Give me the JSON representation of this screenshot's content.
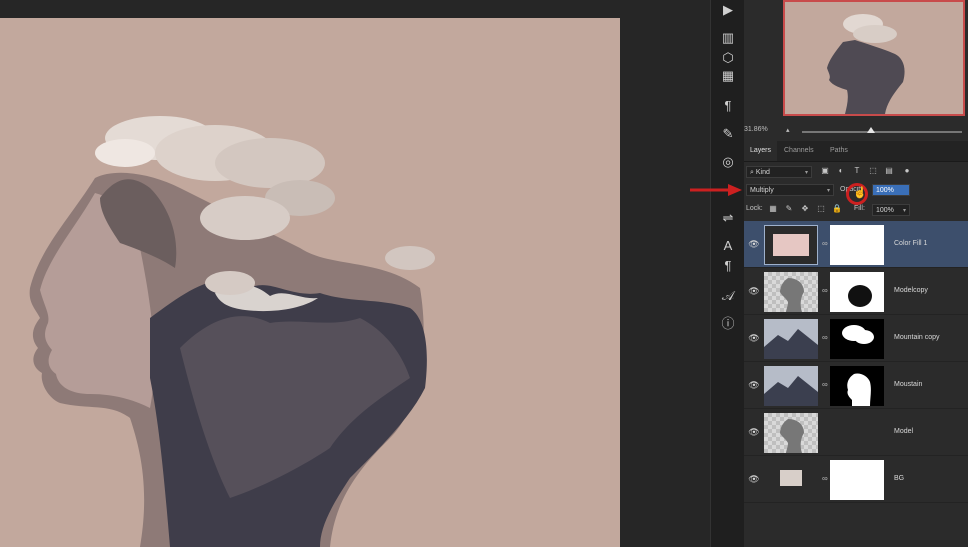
{
  "canvas": {
    "background_color": "#c2a89d",
    "artwork": "double-exposure-portrait"
  },
  "tools": [
    {
      "icon": "play-icon"
    },
    {
      "icon": "histogram-icon"
    },
    {
      "icon": "3d-cube-icon"
    },
    {
      "icon": "swatches-icon"
    },
    {
      "icon": "paragraph-styles-icon"
    },
    {
      "icon": "brush-presets-icon"
    },
    {
      "icon": "libraries-icon"
    },
    {
      "icon": "adjust-levels-icon"
    },
    {
      "icon": "character-icon"
    },
    {
      "icon": "paragraph-icon"
    },
    {
      "icon": "glyphs-icon"
    },
    {
      "icon": "info-icon"
    }
  ],
  "navigator": {
    "zoom_percent": "31.86%",
    "zoom_level": 0.43
  },
  "tabs": [
    {
      "label": "Layers",
      "active": true
    },
    {
      "label": "Channels",
      "active": false
    },
    {
      "label": "Paths",
      "active": false
    }
  ],
  "layers_panel": {
    "filter_kind": "Kind",
    "blend_mode": "Multiply",
    "opacity_label": "Opacity:",
    "opacity_value": "100%",
    "lock_label": "Lock:",
    "fill_label": "Fill:",
    "fill_value": "100%"
  },
  "layers": [
    {
      "name": "Color Fill 1",
      "selected": true,
      "thumb": "pink-fill",
      "mask": "white"
    },
    {
      "name": "Modelcopy",
      "selected": false,
      "thumb": "portrait",
      "mask": "soft-blob"
    },
    {
      "name": "Mountain copy",
      "selected": false,
      "thumb": "mountain",
      "mask": "cloud-shape"
    },
    {
      "name": "Moustain",
      "selected": false,
      "thumb": "mountain",
      "mask": "head-shape"
    },
    {
      "name": "Model",
      "selected": false,
      "thumb": "portrait",
      "mask": "none"
    },
    {
      "name": "BG",
      "selected": false,
      "thumb": "solid-fill",
      "mask": "white"
    }
  ],
  "colors": {
    "accent_red": "#cc2020",
    "selection": "#3d4f6c",
    "pink_fill": "#e6c7c3"
  }
}
